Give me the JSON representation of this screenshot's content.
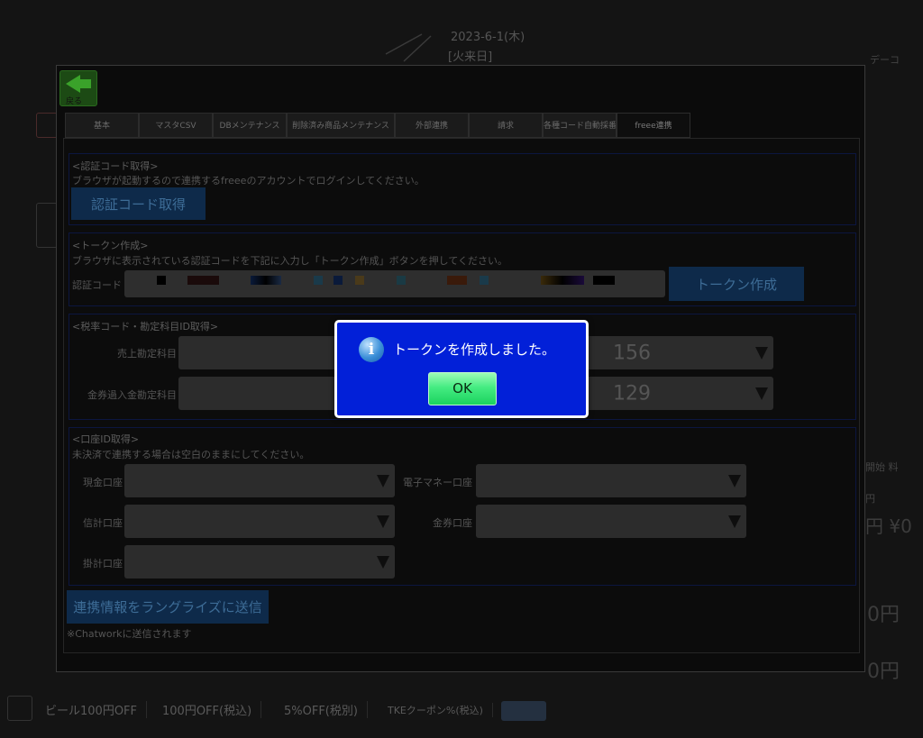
{
  "background": {
    "date": "2023-6-1(木)",
    "day_label": "[火来日]",
    "top_right": "デーコ",
    "side_a": "開始 料",
    "side_b": "円",
    "yen_value": "円 ¥0",
    "amount1": "0円",
    "amount2": "0円",
    "bottom_bar": [
      "ビール100円OFF",
      "100円OFF(税込)",
      "5%OFF(税別)",
      "TKEクーポン%(税込)"
    ]
  },
  "settings": {
    "back_label": "戻る",
    "tabs": [
      "基本",
      "マスタCSV",
      "DBメンテナンス",
      "削除済み商品メンテナンス",
      "外部連携",
      "請求",
      "各種コード自動採番",
      "freee連携"
    ],
    "auth": {
      "title": "<認証コード取得>",
      "desc": "ブラウザが起動するので連携するfreeeのアカウントでログインしてください。",
      "button": "認証コード取得"
    },
    "token": {
      "title": "<トークン作成>",
      "desc": "ブラウザに表示されている認証コードを下記に入力し「トークン作成」ボタンを押してください。",
      "code_label": "認証コード",
      "button": "トークン作成"
    },
    "tax": {
      "title": "<税率コード・勘定科目ID取得>",
      "rows": [
        {
          "label": "売上勘定科目",
          "value": "156"
        },
        {
          "label": "金券過入金勘定科目",
          "value": "129"
        }
      ]
    },
    "account": {
      "title": "<口座ID取得>",
      "desc": "未決済で連携する場合は空白のままにしてください。",
      "fields": {
        "cash": "現金口座",
        "emoney": "電子マネー口座",
        "credit": "信計口座",
        "voucher": "金券口座",
        "other": "掛計口座"
      }
    },
    "send_button": "連携情報をラングライズに送信",
    "note": "※Chatworkに送信されます"
  },
  "modal": {
    "icon": "info-icon",
    "message": "トークンを作成しました。",
    "ok_label": "OK",
    "background_color": "#0220d8"
  }
}
